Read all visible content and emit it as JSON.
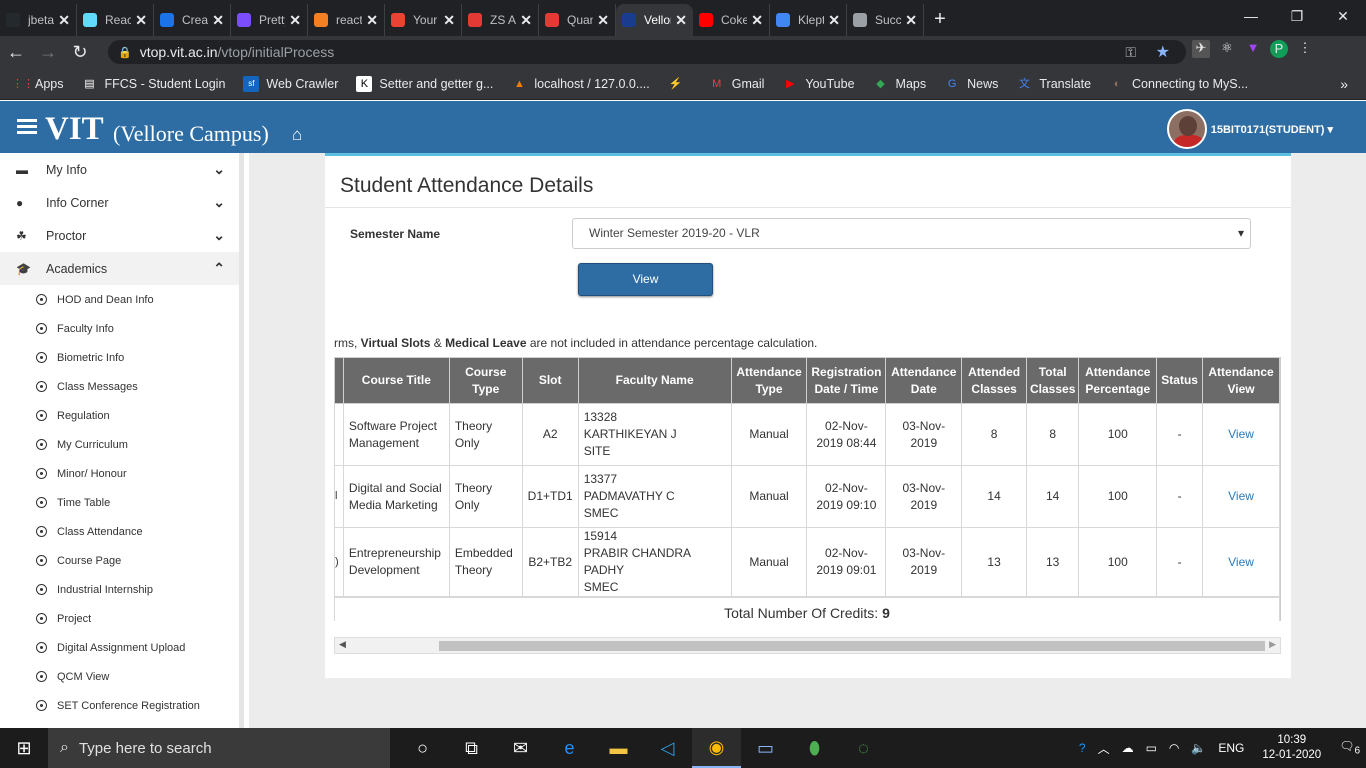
{
  "browser": {
    "tabs": [
      {
        "label": "jbetar",
        "fav_color": "#24292e",
        "icon": "github-icon"
      },
      {
        "label": "React",
        "fav_color": "#61dafb",
        "icon": "react-icon"
      },
      {
        "label": "Creat",
        "fav_color": "#1a73e8",
        "icon": "form-icon"
      },
      {
        "label": "Pretty",
        "fav_color": "#7c4dff",
        "icon": "prettier-icon"
      },
      {
        "label": "reactj",
        "fav_color": "#f48024",
        "icon": "stackoverflow-icon"
      },
      {
        "label": "Your p",
        "fav_color": "#ea4335",
        "icon": "gmail-icon"
      },
      {
        "label": "ZS As",
        "fav_color": "#e53935",
        "icon": "zs-icon"
      },
      {
        "label": "Quan",
        "fav_color": "#e53935",
        "icon": "quant-icon"
      },
      {
        "label": "Vellor",
        "fav_color": "#1a3c8f",
        "icon": "vit-icon",
        "active": true
      },
      {
        "label": "Coke",
        "fav_color": "#ff0000",
        "icon": "youtube-icon"
      },
      {
        "label": "Klept",
        "fav_color": "#4285f4",
        "icon": "google-icon"
      },
      {
        "label": "Succe",
        "fav_color": "#9aa0a6",
        "icon": "globe-icon"
      }
    ],
    "url_host": "vtop.vit.ac.in",
    "url_path": "/vtop/initialProcess",
    "profile_letter": "P",
    "bookmarks": [
      {
        "label": "Apps",
        "icon": "apps-icon"
      },
      {
        "label": "FFCS - Student Login",
        "icon": "ffcs-icon"
      },
      {
        "label": "Web Crawler",
        "icon": "sf-icon"
      },
      {
        "label": "Setter and getter g...",
        "icon": "k-icon"
      },
      {
        "label": "localhost / 127.0.0....",
        "icon": "phpmyadmin-icon"
      },
      {
        "label": "",
        "icon": "bolt-icon"
      },
      {
        "label": "Gmail",
        "icon": "gmail-icon"
      },
      {
        "label": "YouTube",
        "icon": "youtube-icon"
      },
      {
        "label": "Maps",
        "icon": "maps-icon"
      },
      {
        "label": "News",
        "icon": "news-icon"
      },
      {
        "label": "Translate",
        "icon": "translate-icon"
      },
      {
        "label": "Connecting to MyS...",
        "icon": "mysql-icon"
      }
    ]
  },
  "header": {
    "brand": "VIT",
    "campus": "(Vellore Campus)",
    "user": "15BIT0171(STUDENT) ▾"
  },
  "sidebar": {
    "main": [
      {
        "label": "My Info",
        "icon": "briefcase-icon",
        "open": false
      },
      {
        "label": "Info Corner",
        "icon": "info-icon",
        "open": false
      },
      {
        "label": "Proctor",
        "icon": "paw-icon",
        "open": false
      },
      {
        "label": "Academics",
        "icon": "graduation-cap-icon",
        "open": true
      }
    ],
    "sub": [
      "HOD and Dean Info",
      "Faculty Info",
      "Biometric Info",
      "Class Messages",
      "Regulation",
      "My Curriculum",
      "Minor/ Honour",
      "Time Table",
      "Class Attendance",
      "Course Page",
      "Industrial Internship",
      "Project",
      "Digital Assignment Upload",
      "QCM View",
      "SET Conference Registration"
    ]
  },
  "main": {
    "title": "Student Attendance Details",
    "semester_label": "Semester Name",
    "semester_value": "Winter Semester 2019-20 - VLR",
    "view_button": "View",
    "note_prefix": "rms, ",
    "note_b1": "Virtual Slots",
    "note_mid": " & ",
    "note_b2": "Medical Leave",
    "note_suffix": " are not included in attendance percentage calculation.",
    "columns": [
      "",
      "Course Title",
      "Course Type",
      "Slot",
      "Faculty Name",
      "Attendance Type",
      "Registration Date / Time",
      "Attendance Date",
      "Attended Classes",
      "Total Classes",
      "Attendance Percentage",
      "Status",
      "Attendance View"
    ],
    "rows": [
      {
        "lead": "",
        "title": "Software Project Management",
        "type": "Theory Only",
        "slot": "A2",
        "fac_id": "13328",
        "fac_name": "KARTHIKEYAN J",
        "fac_school": "SITE",
        "att_type": "Manual",
        "reg": "02-Nov-2019 08:44",
        "att_date": "03-Nov-2019",
        "attended": "8",
        "total": "8",
        "pct": "100",
        "status": "-",
        "view": "View"
      },
      {
        "lead": "l",
        "title": "Digital and Social Media Marketing",
        "type": "Theory Only",
        "slot": "D1+TD1",
        "fac_id": "13377",
        "fac_name": "PADMAVATHY C",
        "fac_school": "SMEC",
        "att_type": "Manual",
        "reg": "02-Nov-2019 09:10",
        "att_date": "03-Nov-2019",
        "attended": "14",
        "total": "14",
        "pct": "100",
        "status": "-",
        "view": "View"
      },
      {
        "lead": ")",
        "title": "Entrepreneurship Development",
        "type": "Embedded Theory",
        "slot": "B2+TB2",
        "fac_id": "15914",
        "fac_name": "PRABIR CHANDRA PADHY",
        "fac_school": "SMEC",
        "att_type": "Manual",
        "reg": "02-Nov-2019 09:01",
        "att_date": "03-Nov-2019",
        "attended": "13",
        "total": "13",
        "pct": "100",
        "status": "-",
        "view": "View"
      }
    ],
    "credits_label": "Total Number Of Credits:",
    "credits_value": "9"
  },
  "taskbar": {
    "search_placeholder": "Type here to search",
    "lang": "ENG",
    "time": "10:39",
    "date": "12-01-2020",
    "notif_count": "6"
  }
}
